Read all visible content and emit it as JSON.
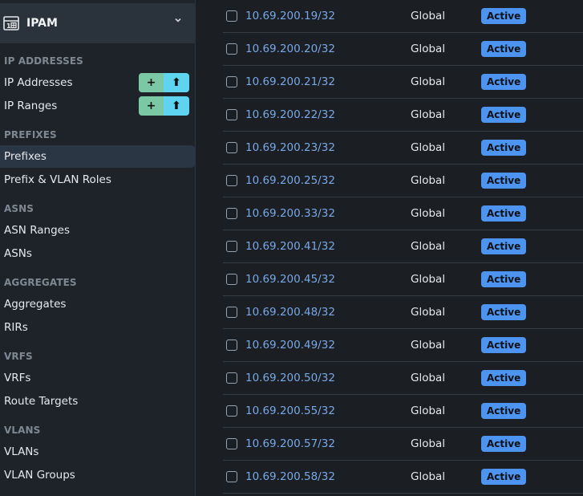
{
  "sidebar": {
    "menu": {
      "title": "IPAM",
      "icon": "ipam-icon",
      "chevron_icon": "chevron-down-icon"
    },
    "sections": [
      {
        "heading": "IP ADDRESSES",
        "items": [
          {
            "label": "IP Addresses",
            "has_buttons": true,
            "add_icon": "+",
            "import_icon": "⬆"
          },
          {
            "label": "IP Ranges",
            "has_buttons": true,
            "add_icon": "+",
            "import_icon": "⬆"
          }
        ]
      },
      {
        "heading": "PREFIXES",
        "items": [
          {
            "label": "Prefixes",
            "active": true
          },
          {
            "label": "Prefix & VLAN Roles"
          }
        ]
      },
      {
        "heading": "ASNS",
        "items": [
          {
            "label": "ASN Ranges"
          },
          {
            "label": "ASNs"
          }
        ]
      },
      {
        "heading": "AGGREGATES",
        "items": [
          {
            "label": "Aggregates"
          },
          {
            "label": "RIRs"
          }
        ]
      },
      {
        "heading": "VRFS",
        "items": [
          {
            "label": "VRFs"
          },
          {
            "label": "Route Targets"
          }
        ]
      },
      {
        "heading": "VLANS",
        "items": [
          {
            "label": "VLANs"
          },
          {
            "label": "VLAN Groups"
          }
        ]
      }
    ]
  },
  "table": {
    "rows": [
      {
        "prefix": "10.69.200.19/32",
        "vrf": "Global",
        "status": "Active"
      },
      {
        "prefix": "10.69.200.20/32",
        "vrf": "Global",
        "status": "Active"
      },
      {
        "prefix": "10.69.200.21/32",
        "vrf": "Global",
        "status": "Active"
      },
      {
        "prefix": "10.69.200.22/32",
        "vrf": "Global",
        "status": "Active"
      },
      {
        "prefix": "10.69.200.23/32",
        "vrf": "Global",
        "status": "Active"
      },
      {
        "prefix": "10.69.200.25/32",
        "vrf": "Global",
        "status": "Active"
      },
      {
        "prefix": "10.69.200.33/32",
        "vrf": "Global",
        "status": "Active"
      },
      {
        "prefix": "10.69.200.41/32",
        "vrf": "Global",
        "status": "Active"
      },
      {
        "prefix": "10.69.200.45/32",
        "vrf": "Global",
        "status": "Active"
      },
      {
        "prefix": "10.69.200.48/32",
        "vrf": "Global",
        "status": "Active"
      },
      {
        "prefix": "10.69.200.49/32",
        "vrf": "Global",
        "status": "Active"
      },
      {
        "prefix": "10.69.200.50/32",
        "vrf": "Global",
        "status": "Active"
      },
      {
        "prefix": "10.69.200.55/32",
        "vrf": "Global",
        "status": "Active"
      },
      {
        "prefix": "10.69.200.57/32",
        "vrf": "Global",
        "status": "Active"
      },
      {
        "prefix": "10.69.200.58/32",
        "vrf": "Global",
        "status": "Active"
      }
    ]
  },
  "colors": {
    "sidebar_bg": "#1e232a",
    "menu_header_bg": "#2a323c",
    "active_item_bg": "#2a3644",
    "link": "#79a8e6",
    "badge_active": "#4d94f0",
    "btn_add": "#7bc8a4",
    "btn_import": "#5fd4f0"
  }
}
